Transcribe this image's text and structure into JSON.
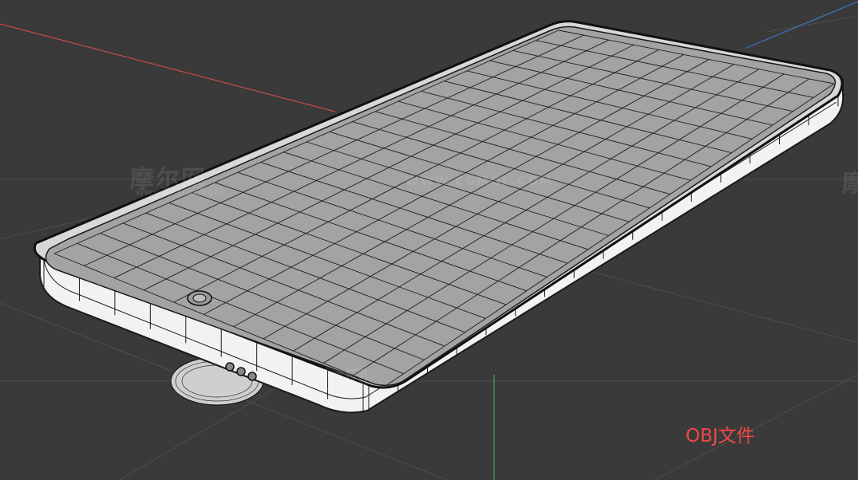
{
  "viewport": {
    "background": "#3a3a3a",
    "grid_color": "#4e4e4e",
    "axis_x_color": "#c84a4a",
    "axis_y_color": "#3fa35e",
    "axis_z_color": "#3f74c8"
  },
  "model": {
    "screen_color": "#a3a3a3",
    "frame_color": "#f2f2f2",
    "wire_color": "#1a1a1a"
  },
  "watermarks": {
    "brand_cn": "摩尔网",
    "brand_url": "WWW.CGMOL.COM",
    "brand_sub": "WWW.CGMOL.COM"
  },
  "label": {
    "text": "OBJ文件",
    "color": "#f04848"
  }
}
